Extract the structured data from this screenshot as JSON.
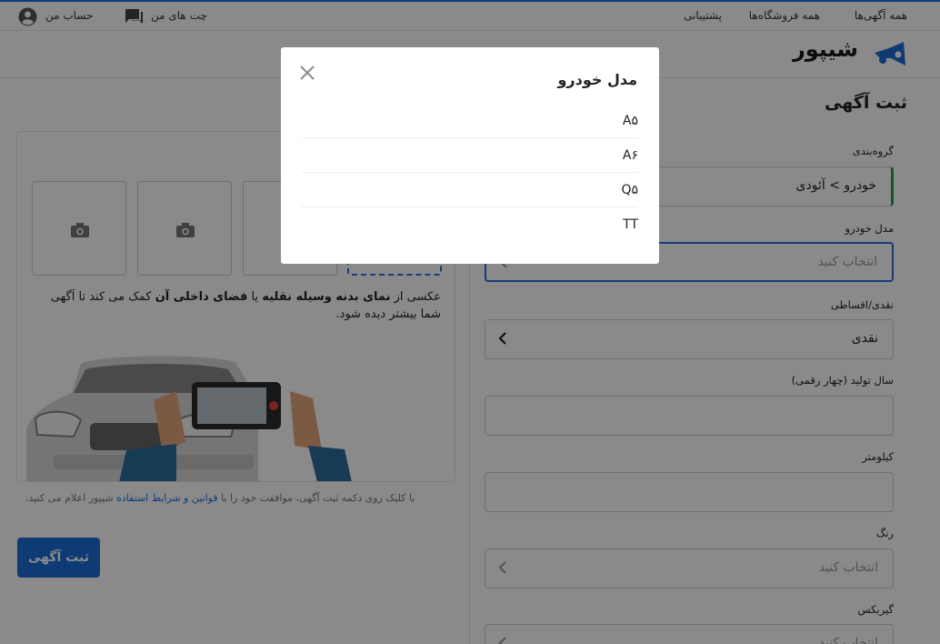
{
  "topbar": {
    "all_ads": "همه آگهی‌ها",
    "all_stores": "همه فروشگاه‌ها",
    "support": "پشتیبانی",
    "my_chats": "چت های من",
    "my_account": "حساب من"
  },
  "brand": {
    "name": "شیپور",
    "color": "#1c6ed8"
  },
  "page": {
    "title": "ثبت آگهی"
  },
  "photos": {
    "help_part1": "عکسی از ",
    "help_bold1": "نمای بدنه وسیله نقلیه",
    "help_part2": " یا ",
    "help_bold2": "فضای داخلی آن",
    "help_part3": " کمک می کند تا آگهی شما بیشتر دیده شود."
  },
  "agreement": {
    "before": "با کلیک روی دکمه ثبت آگهی، موافقت خود را با ",
    "link": "قوانین و شرایط استفاده",
    "after": " شیپور اعلام می کنید."
  },
  "submit_label": "ثبت آگهی",
  "form": {
    "category": {
      "label": "گروه‌بندی",
      "value": "خودرو > آئودی"
    },
    "model": {
      "label": "مدل خودرو",
      "placeholder": "انتخاب کنید"
    },
    "payment": {
      "label": "نقدی/اقساطی",
      "value": "نقدی"
    },
    "year": {
      "label": "سال تولید (چهار رقمی)",
      "value": ""
    },
    "mileage": {
      "label": "کیلومتر",
      "value": ""
    },
    "color": {
      "label": "رنگ",
      "placeholder": "انتخاب کنید"
    },
    "gearbox": {
      "label": "گیربکس",
      "placeholder": "انتخاب کنید"
    }
  },
  "modal": {
    "title": "مدل خودرو",
    "options": [
      "A۵",
      "A۶",
      "Q۵",
      "TT"
    ]
  },
  "colors": {
    "accent": "#1c6ed8",
    "active_border": "#2b6de0",
    "category_indicator": "#1fa35a"
  }
}
